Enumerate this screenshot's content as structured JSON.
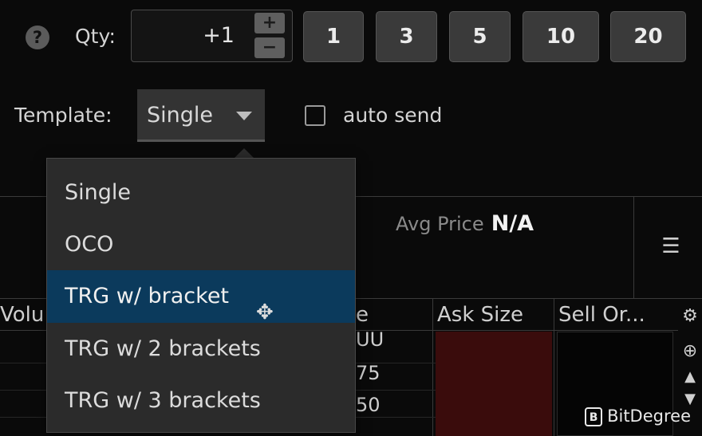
{
  "order": {
    "help_icon_glyph": "?",
    "qty_label": "Qty:",
    "qty_value": "+1",
    "increment": "+",
    "decrement": "−",
    "presets": [
      "1",
      "3",
      "5",
      "10",
      "20"
    ]
  },
  "template": {
    "label": "Template:",
    "selected": "Single",
    "auto_send_label": "auto send",
    "auto_send_checked": false,
    "options": [
      "Single",
      "OCO",
      "TRG w/ bracket",
      "TRG w/ 2 brackets",
      "TRG w/ 3 brackets"
    ],
    "highlighted_index": 2
  },
  "position": {
    "avg_price_label": "Avg Price",
    "avg_price_value": "N/A"
  },
  "ladder": {
    "headers": {
      "volume": "Volu",
      "price": "e",
      "ask_size": "Ask Size",
      "sell_orders": "Sell Or..."
    },
    "price_fragments": [
      "UU",
      "75",
      "50"
    ]
  },
  "watermark": {
    "text": "BitDegree",
    "logo_glyph": "B"
  },
  "colors": {
    "highlight": "#0b3a5c",
    "ask_bg": "#3a0c0c",
    "background": "#0a0a0a"
  }
}
